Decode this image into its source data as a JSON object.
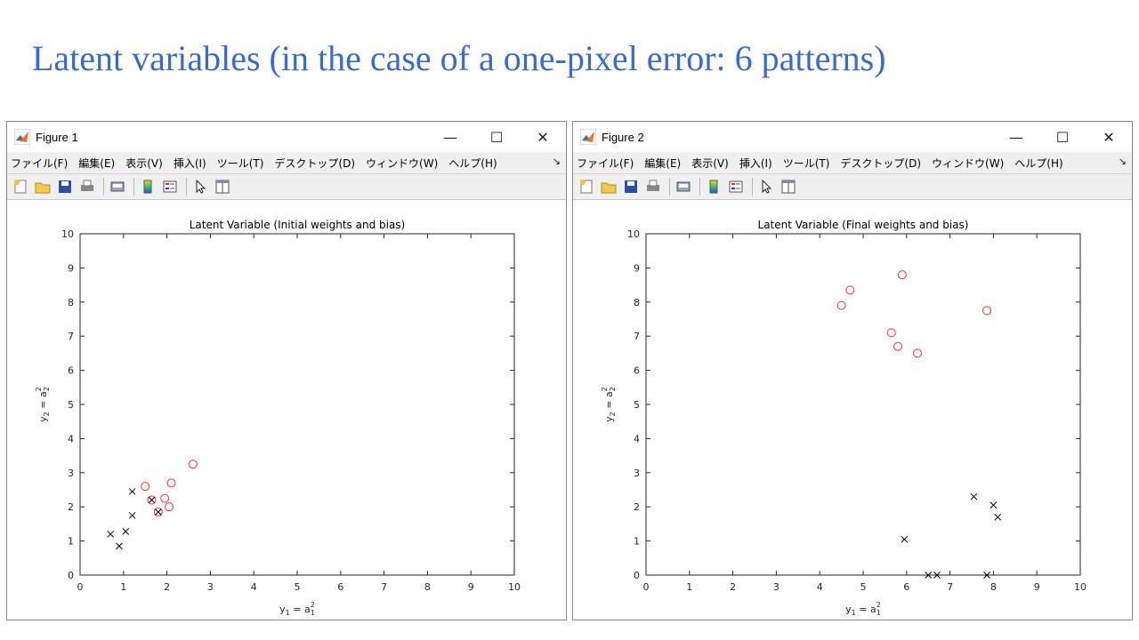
{
  "slide": {
    "title": "Latent variables (in the case of a one-pixel error: 6 patterns)"
  },
  "colors": {
    "title": "#3b6cc8",
    "circle": "#e8353a",
    "cross": "#000000"
  },
  "menu": [
    "ファイル(F)",
    "編集(E)",
    "表示(V)",
    "挿入(I)",
    "ツール(T)",
    "デスクトップ(D)",
    "ウィンドウ(W)",
    "ヘルプ(H)"
  ],
  "window_controls": {
    "minimize": "—",
    "maximize": "☐",
    "close": "✕"
  },
  "toolbar_icons": [
    "new-figure-icon",
    "open-file-icon",
    "save-icon",
    "print-icon",
    "print-preview-icon",
    "colorbar-icon",
    "legend-icon",
    "pointer-icon",
    "property-editor-icon"
  ],
  "figures": [
    {
      "window_title": "Figure 1",
      "chart_data": {
        "type": "scatter",
        "title": "Latent Variable (Initial weights and bias)",
        "xlabel": "y1 = a1^2",
        "ylabel": "y2 = a2^2",
        "xlim": [
          0,
          10
        ],
        "ylim": [
          0,
          10
        ],
        "xticks": [
          "0",
          "1",
          "2",
          "3",
          "4",
          "5",
          "6",
          "7",
          "8",
          "9",
          "10"
        ],
        "yticks": [
          "0",
          "1",
          "2",
          "3",
          "4",
          "5",
          "6",
          "7",
          "8",
          "9",
          "10"
        ],
        "series": [
          {
            "marker": "o",
            "color": "#e8353a",
            "points": [
              [
                1.5,
                2.6
              ],
              [
                1.65,
                2.2
              ],
              [
                1.8,
                1.85
              ],
              [
                1.95,
                2.25
              ],
              [
                2.05,
                2.0
              ],
              [
                2.1,
                2.7
              ],
              [
                2.6,
                3.25
              ]
            ]
          },
          {
            "marker": "x",
            "color": "#000000",
            "points": [
              [
                0.7,
                1.2
              ],
              [
                0.9,
                0.85
              ],
              [
                1.05,
                1.28
              ],
              [
                1.2,
                1.75
              ],
              [
                1.2,
                2.45
              ],
              [
                1.65,
                2.2
              ],
              [
                1.8,
                1.85
              ]
            ]
          }
        ]
      }
    },
    {
      "window_title": "Figure 2",
      "chart_data": {
        "type": "scatter",
        "title": "Latent Variable (Final weights and bias)",
        "xlabel": "y1 = a1^2",
        "ylabel": "y2 = a2^2",
        "xlim": [
          0,
          10
        ],
        "ylim": [
          0,
          10
        ],
        "xticks": [
          "0",
          "1",
          "2",
          "3",
          "4",
          "5",
          "6",
          "7",
          "8",
          "9",
          "10"
        ],
        "yticks": [
          "0",
          "1",
          "2",
          "3",
          "4",
          "5",
          "6",
          "7",
          "8",
          "9",
          "10"
        ],
        "series": [
          {
            "marker": "o",
            "color": "#e8353a",
            "points": [
              [
                4.5,
                7.9
              ],
              [
                4.7,
                8.35
              ],
              [
                5.65,
                7.1
              ],
              [
                5.8,
                6.7
              ],
              [
                5.9,
                8.8
              ],
              [
                6.25,
                6.5
              ],
              [
                7.85,
                7.75
              ]
            ]
          },
          {
            "marker": "x",
            "color": "#000000",
            "points": [
              [
                5.95,
                1.05
              ],
              [
                6.5,
                0.0
              ],
              [
                6.7,
                0.0
              ],
              [
                7.55,
                2.3
              ],
              [
                7.85,
                0.0
              ],
              [
                8.0,
                2.05
              ],
              [
                8.1,
                1.7
              ]
            ]
          }
        ]
      }
    }
  ]
}
